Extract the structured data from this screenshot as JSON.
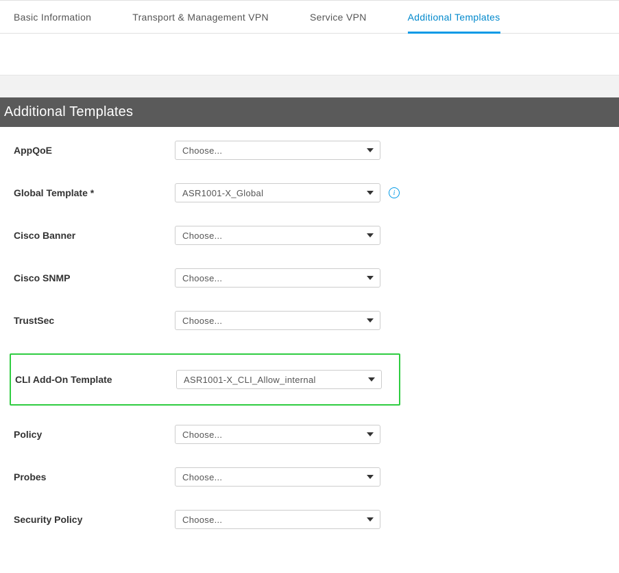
{
  "tabs": [
    {
      "label": "Basic Information"
    },
    {
      "label": "Transport & Management VPN"
    },
    {
      "label": "Service VPN"
    },
    {
      "label": "Additional Templates"
    }
  ],
  "active_tab_index": 3,
  "section_title": "Additional Templates",
  "placeholder_choose": "Choose...",
  "fields": {
    "appqoe": {
      "label": "AppQoE",
      "value": "Choose..."
    },
    "global_template": {
      "label": "Global Template *",
      "value": "ASR1001-X_Global"
    },
    "cisco_banner": {
      "label": "Cisco Banner",
      "value": "Choose..."
    },
    "cisco_snmp": {
      "label": "Cisco SNMP",
      "value": "Choose..."
    },
    "trustsec": {
      "label": "TrustSec",
      "value": "Choose..."
    },
    "cli_addon": {
      "label": "CLI Add-On Template",
      "value": "ASR1001-X_CLI_Allow_internal"
    },
    "policy": {
      "label": "Policy",
      "value": "Choose..."
    },
    "probes": {
      "label": "Probes",
      "value": "Choose..."
    },
    "security_policy": {
      "label": "Security Policy",
      "value": "Choose..."
    }
  }
}
